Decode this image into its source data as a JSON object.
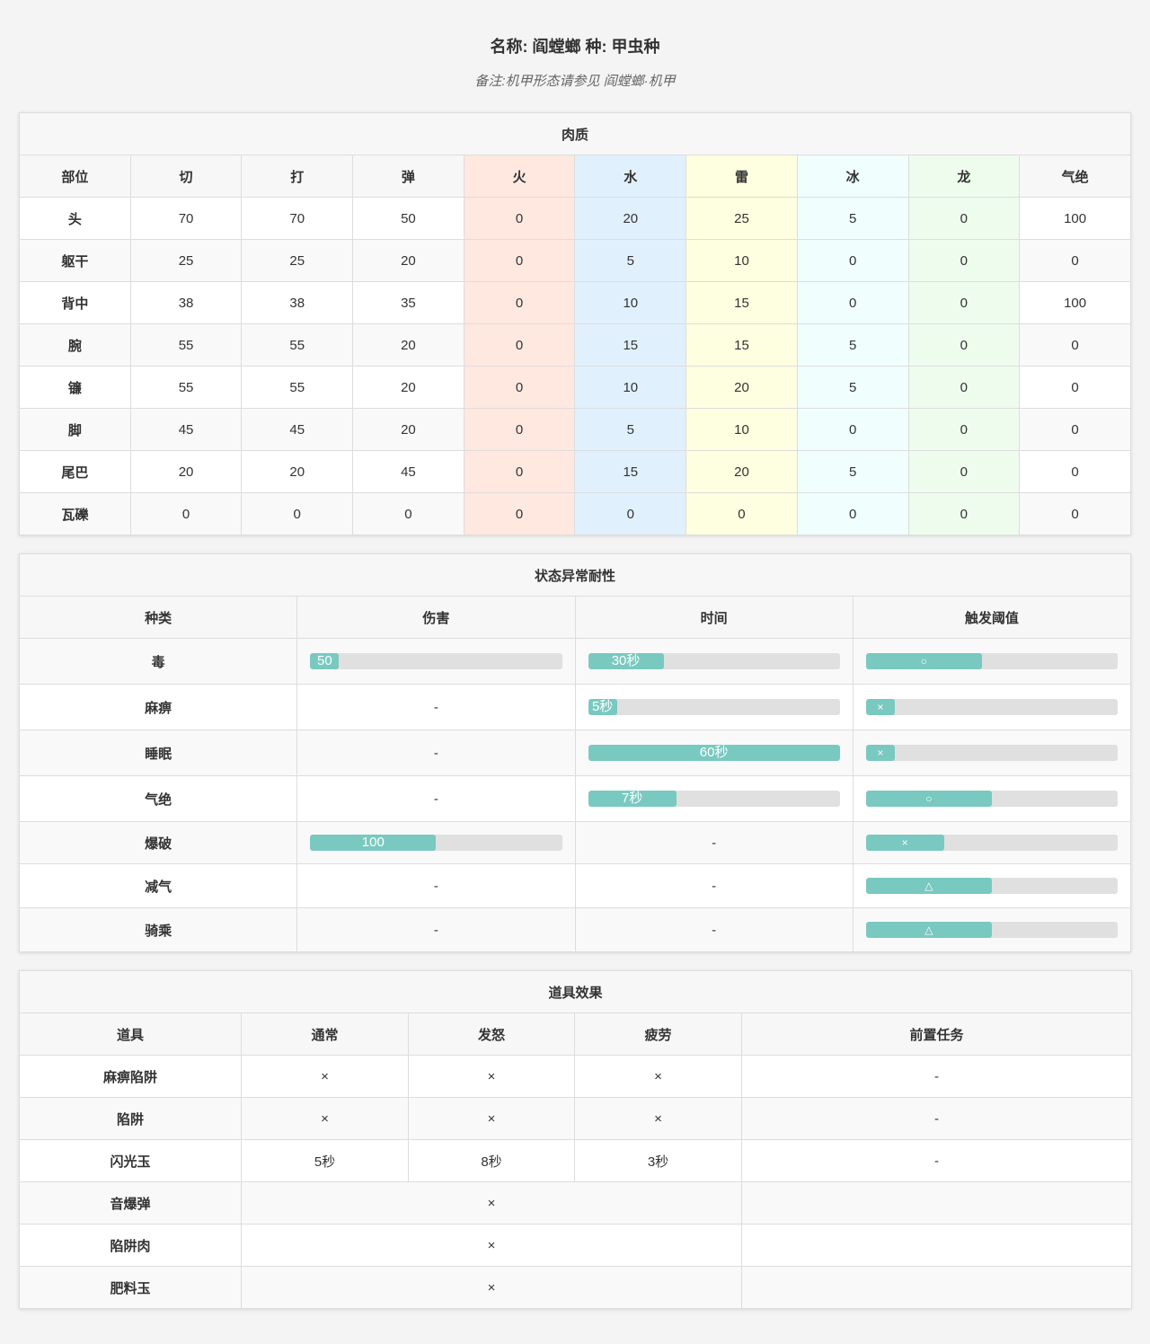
{
  "header": {
    "title": "名称: 阎螳螂 种: 甲虫种",
    "note": "备注:机甲形态请参见 阎螳螂·机甲"
  },
  "hitzones": {
    "title": "肉质",
    "columns": [
      "部位",
      "切",
      "打",
      "弹",
      "火",
      "水",
      "雷",
      "冰",
      "龙",
      "气绝"
    ],
    "rows": [
      [
        "头",
        "70",
        "70",
        "50",
        "0",
        "20",
        "25",
        "5",
        "0",
        "100"
      ],
      [
        "躯干",
        "25",
        "25",
        "20",
        "0",
        "5",
        "10",
        "0",
        "0",
        "0"
      ],
      [
        "背中",
        "38",
        "38",
        "35",
        "0",
        "10",
        "15",
        "0",
        "0",
        "100"
      ],
      [
        "腕",
        "55",
        "55",
        "20",
        "0",
        "15",
        "15",
        "5",
        "0",
        "0"
      ],
      [
        "镰",
        "55",
        "55",
        "20",
        "0",
        "10",
        "20",
        "5",
        "0",
        "0"
      ],
      [
        "脚",
        "45",
        "45",
        "20",
        "0",
        "5",
        "10",
        "0",
        "0",
        "0"
      ],
      [
        "尾巴",
        "20",
        "20",
        "45",
        "0",
        "15",
        "20",
        "5",
        "0",
        "0"
      ],
      [
        "瓦礫",
        "0",
        "0",
        "0",
        "0",
        "0",
        "0",
        "0",
        "0",
        "0"
      ]
    ]
  },
  "status": {
    "title": "状态异常耐性",
    "columns": [
      "种类",
      "伤害",
      "时间",
      "触发阈值"
    ],
    "rows": [
      {
        "name": "毒",
        "damage": {
          "label": "50",
          "fraction": 0.115
        },
        "duration": {
          "label": "30秒",
          "fraction": 0.3
        },
        "threshold": {
          "label": "○",
          "fraction": 0.46
        }
      },
      {
        "name": "麻痹",
        "damage": null,
        "duration": {
          "label": "5秒",
          "fraction": 0.115
        },
        "threshold": {
          "label": "×",
          "fraction": 0.115
        }
      },
      {
        "name": "睡眠",
        "damage": null,
        "duration": {
          "label": "60秒",
          "fraction": 1.0
        },
        "threshold": {
          "label": "×",
          "fraction": 0.115
        }
      },
      {
        "name": "气绝",
        "damage": null,
        "duration": {
          "label": "7秒",
          "fraction": 0.35
        },
        "threshold": {
          "label": "○",
          "fraction": 0.5
        }
      },
      {
        "name": "爆破",
        "damage": {
          "label": "100",
          "fraction": 0.5
        },
        "duration": null,
        "threshold": {
          "label": "×",
          "fraction": 0.31
        }
      },
      {
        "name": "减气",
        "damage": null,
        "duration": null,
        "threshold": {
          "label": "△",
          "fraction": 0.5
        }
      },
      {
        "name": "骑乘",
        "damage": null,
        "duration": null,
        "threshold": {
          "label": "△",
          "fraction": 0.5
        }
      }
    ],
    "empty_mark": "-"
  },
  "items": {
    "title": "道具效果",
    "columns": [
      "道具",
      "通常",
      "发怒",
      "疲劳",
      "前置任务"
    ],
    "rows": [
      {
        "name": "麻痹陷阱",
        "cells": [
          "×",
          "×",
          "×"
        ],
        "prereq": "-"
      },
      {
        "name": "陷阱",
        "cells": [
          "×",
          "×",
          "×"
        ],
        "prereq": "-"
      },
      {
        "name": "闪光玉",
        "cells": [
          "5秒",
          "8秒",
          "3秒"
        ],
        "prereq": "-"
      },
      {
        "name": "音爆弹",
        "merged": "×",
        "prereq": ""
      },
      {
        "name": "陷阱肉",
        "merged": "×",
        "prereq": ""
      },
      {
        "name": "肥料玉",
        "merged": "×",
        "prereq": ""
      }
    ]
  },
  "colors": {
    "bar_fill": "#79c9c0",
    "bar_track": "#e0e0e0",
    "fire": "#ffe8df",
    "water": "#e1f0fd",
    "thunder": "#fefee0",
    "ice": "#f0fefe",
    "dragon": "#eefcee"
  }
}
